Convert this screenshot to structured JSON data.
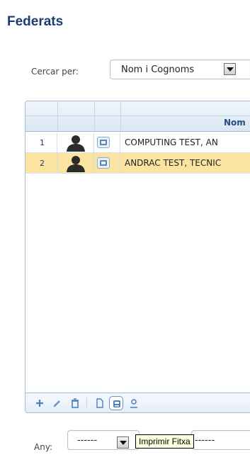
{
  "page": {
    "title": "Federats"
  },
  "search": {
    "label": "Cercar per:",
    "selected": "Nom i Cognoms"
  },
  "grid": {
    "header": {
      "name_column": "Nom"
    },
    "rows": [
      {
        "num": "1",
        "name": "COMPUTING TEST, AN",
        "selected": false
      },
      {
        "num": "2",
        "name": "ANDRAC TEST, TECNIC",
        "selected": true
      }
    ],
    "toolbar_icons": [
      "add-icon",
      "edit-icon",
      "delete-icon",
      "document-icon",
      "print-icon",
      "person-icon"
    ]
  },
  "filter": {
    "year_label": "Any:",
    "year_value": "------",
    "second_value": "------"
  },
  "tooltip": {
    "text": "Imprimir Fitxa"
  },
  "colors": {
    "title": "#1d3d72",
    "selected_row": "#fbe3a0",
    "grid_border": "#a7bad3",
    "header_bg": "#dde8f5"
  }
}
